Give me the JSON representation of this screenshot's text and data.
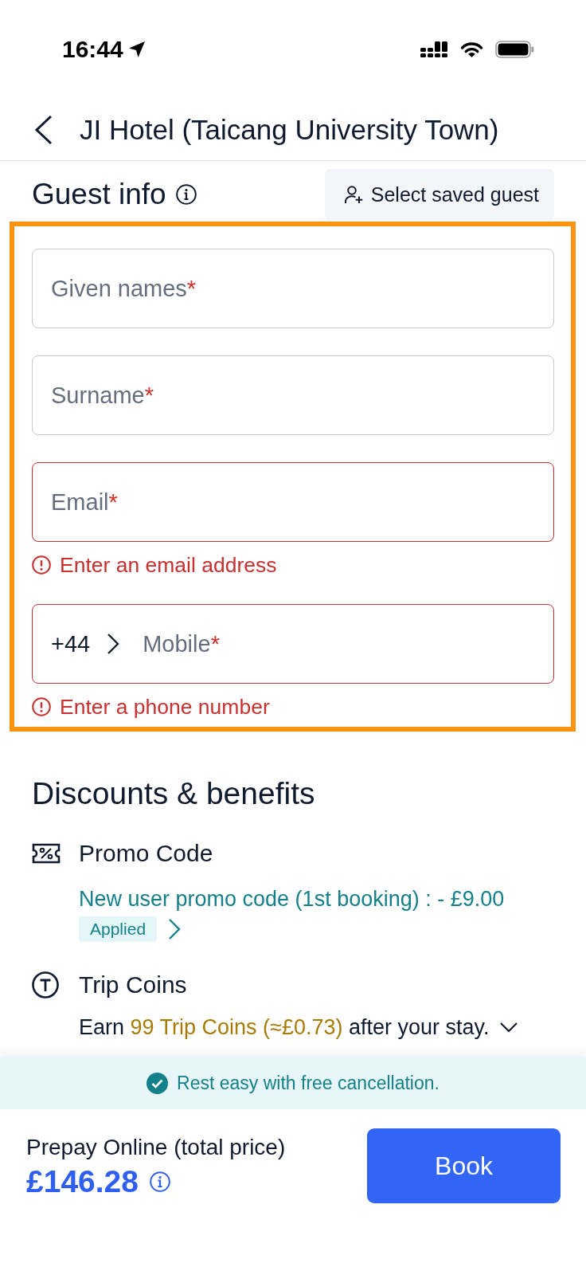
{
  "status_bar": {
    "time": "16:44"
  },
  "header": {
    "title": "JI Hotel (Taicang University Town)"
  },
  "guest_info": {
    "heading": "Guest info",
    "select_saved_button": "Select saved guest"
  },
  "guest_form": {
    "highlighted": true,
    "fields": [
      {
        "kind": "text",
        "placeholder": "Given names",
        "required_mark": "*",
        "invalid": false
      },
      {
        "kind": "text",
        "placeholder": "Surname",
        "required_mark": "*",
        "invalid": false
      },
      {
        "kind": "text",
        "placeholder": "Email",
        "required_mark": "*",
        "invalid": true,
        "error": "Enter an email address"
      },
      {
        "kind": "phone",
        "country_code": "+44",
        "placeholder": "Mobile",
        "required_mark": "*",
        "invalid": true,
        "error": "Enter a phone number"
      }
    ]
  },
  "discounts": {
    "heading": "Discounts & benefits",
    "items": [
      {
        "kind": "promo",
        "title": "Promo Code",
        "detail": "New user promo code (1st booking) : - £9.00",
        "badge": "Applied"
      },
      {
        "kind": "coins",
        "title": "Trip Coins",
        "detail_parts": [
          {
            "text": "Earn ",
            "highlight": false
          },
          {
            "text": "99 Trip Coins (≈£0.73)",
            "highlight": true
          },
          {
            "text": " after your stay.",
            "highlight": false
          }
        ]
      }
    ]
  },
  "banner": {
    "text": "Rest easy with free cancellation."
  },
  "footer": {
    "label": "Prepay Online (total price)",
    "price": "£146.28",
    "book_button": "Book"
  }
}
